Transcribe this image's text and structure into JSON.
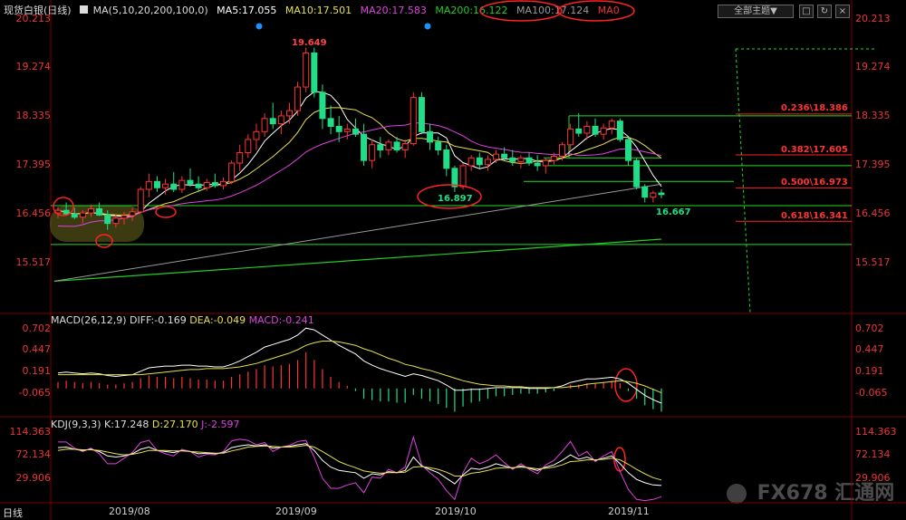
{
  "header": {
    "title": "现货白银(日线)",
    "ma_params": "MA(5,10,20,200,100,0)",
    "ma5": "MA5:17.055",
    "ma10": "MA10:17.501",
    "ma20": "MA20:17.583",
    "ma200": "MA200:16.122",
    "ma100": "MA100:17.124",
    "ma0": "MA0",
    "theme_button": "全部主题▼"
  },
  "colors": {
    "bg": "#000000",
    "up": "#ff3333",
    "down": "#22dd88",
    "axis": "#ff3333",
    "ma5": "#ffffff",
    "ma10": "#e8e04a",
    "ma20": "#e040e0",
    "ma100": "#999999",
    "ma200": "#22cc22"
  },
  "price_axis": [
    "20.213",
    "19.274",
    "18.335",
    "17.395",
    "16.456",
    "15.517"
  ],
  "annotations": {
    "high": "19.649",
    "low": "16.897",
    "last": "16.667"
  },
  "fib_levels": [
    "0.236\\18.386",
    "0.382\\17.605",
    "0.500\\16.973",
    "0.618\\16.341"
  ],
  "macd": {
    "label": "MACD(26,12,9)",
    "diff": "DIFF:-0.169",
    "dea": "DEA:-0.049",
    "macd": "MACD:-0.241",
    "axis": [
      "0.702",
      "0.447",
      "0.191",
      "-0.065"
    ]
  },
  "kdj": {
    "label": "KDJ(9,3,3)",
    "k": "K:17.248",
    "d": "D:27.170",
    "j": "J:-2.597",
    "axis": [
      "114.363",
      "72.134",
      "29.906"
    ]
  },
  "x_axis": [
    "2019/08",
    "2019/09",
    "2019/10",
    "2019/11"
  ],
  "footer": {
    "period": "日线",
    "watermark_brand": "FX678",
    "watermark_cn": "汇通网"
  },
  "chart_data": {
    "type": "candlestick",
    "title": "现货白银(日线)",
    "ylim": [
      15.3,
      20.4
    ],
    "ohlc": [
      [
        16.5,
        16.62,
        16.4,
        16.55
      ],
      [
        16.55,
        16.7,
        16.45,
        16.48
      ],
      [
        16.48,
        16.6,
        16.38,
        16.42
      ],
      [
        16.42,
        16.55,
        16.3,
        16.5
      ],
      [
        16.5,
        16.66,
        16.42,
        16.58
      ],
      [
        16.58,
        16.7,
        16.44,
        16.46
      ],
      [
        16.46,
        16.55,
        16.18,
        16.3
      ],
      [
        16.3,
        16.48,
        16.22,
        16.4
      ],
      [
        16.4,
        16.52,
        16.28,
        16.45
      ],
      [
        16.45,
        16.6,
        16.35,
        16.52
      ],
      [
        16.52,
        17.0,
        16.5,
        16.95
      ],
      [
        16.95,
        17.25,
        16.8,
        17.1
      ],
      [
        17.1,
        17.2,
        16.9,
        16.98
      ],
      [
        16.98,
        17.15,
        16.85,
        17.05
      ],
      [
        17.05,
        17.28,
        16.9,
        16.95
      ],
      [
        16.95,
        17.2,
        16.88,
        17.12
      ],
      [
        17.12,
        17.35,
        17.0,
        17.05
      ],
      [
        17.05,
        17.2,
        16.9,
        16.98
      ],
      [
        16.98,
        17.15,
        16.92,
        17.08
      ],
      [
        17.08,
        17.25,
        16.98,
        17.02
      ],
      [
        17.02,
        17.18,
        16.95,
        17.1
      ],
      [
        17.1,
        17.5,
        17.05,
        17.45
      ],
      [
        17.45,
        17.8,
        17.3,
        17.65
      ],
      [
        17.65,
        18.0,
        17.55,
        17.9
      ],
      [
        17.9,
        18.2,
        17.7,
        18.05
      ],
      [
        18.05,
        18.4,
        17.95,
        18.3
      ],
      [
        18.3,
        18.6,
        18.1,
        18.2
      ],
      [
        18.2,
        18.45,
        18.0,
        18.35
      ],
      [
        18.35,
        18.6,
        18.2,
        18.45
      ],
      [
        18.45,
        19.0,
        18.35,
        18.9
      ],
      [
        18.9,
        19.65,
        18.8,
        19.55
      ],
      [
        19.55,
        19.65,
        18.7,
        18.8
      ],
      [
        18.8,
        18.95,
        18.1,
        18.3
      ],
      [
        18.3,
        18.55,
        18.0,
        18.15
      ],
      [
        18.15,
        18.35,
        17.85,
        18.05
      ],
      [
        18.05,
        18.2,
        17.9,
        18.1
      ],
      [
        18.1,
        18.3,
        17.95,
        18.0
      ],
      [
        18.0,
        18.2,
        17.4,
        17.5
      ],
      [
        17.5,
        17.9,
        17.35,
        17.8
      ],
      [
        17.8,
        17.95,
        17.55,
        17.7
      ],
      [
        17.7,
        17.9,
        17.6,
        17.85
      ],
      [
        17.85,
        17.95,
        17.65,
        17.7
      ],
      [
        17.7,
        17.9,
        17.55,
        17.82
      ],
      [
        17.82,
        18.8,
        17.78,
        18.7
      ],
      [
        18.7,
        18.8,
        18.0,
        18.05
      ],
      [
        18.05,
        18.2,
        17.7,
        17.85
      ],
      [
        17.85,
        17.95,
        17.6,
        17.7
      ],
      [
        17.7,
        17.8,
        17.2,
        17.35
      ],
      [
        17.35,
        17.4,
        16.9,
        17.0
      ],
      [
        17.0,
        17.45,
        16.95,
        17.4
      ],
      [
        17.4,
        17.6,
        17.3,
        17.55
      ],
      [
        17.55,
        17.65,
        17.35,
        17.42
      ],
      [
        17.42,
        17.6,
        17.3,
        17.52
      ],
      [
        17.52,
        17.7,
        17.45,
        17.62
      ],
      [
        17.62,
        17.75,
        17.5,
        17.55
      ],
      [
        17.55,
        17.7,
        17.4,
        17.48
      ],
      [
        17.48,
        17.6,
        17.35,
        17.55
      ],
      [
        17.55,
        17.65,
        17.4,
        17.45
      ],
      [
        17.45,
        17.6,
        17.3,
        17.4
      ],
      [
        17.4,
        17.55,
        17.25,
        17.5
      ],
      [
        17.5,
        17.65,
        17.42,
        17.58
      ],
      [
        17.58,
        17.85,
        17.5,
        17.8
      ],
      [
        17.8,
        18.2,
        17.7,
        18.1
      ],
      [
        18.1,
        18.4,
        17.95,
        18.02
      ],
      [
        18.02,
        18.25,
        17.9,
        18.15
      ],
      [
        18.15,
        18.3,
        17.95,
        18.0
      ],
      [
        18.0,
        18.2,
        17.9,
        18.12
      ],
      [
        18.12,
        18.3,
        18.0,
        18.25
      ],
      [
        18.25,
        18.3,
        17.85,
        17.9
      ],
      [
        17.9,
        17.95,
        17.4,
        17.5
      ],
      [
        17.5,
        17.55,
        16.95,
        17.0
      ],
      [
        17.0,
        17.05,
        16.7,
        16.8
      ],
      [
        16.8,
        16.92,
        16.7,
        16.88
      ],
      [
        16.88,
        16.95,
        16.78,
        16.85
      ]
    ],
    "fib": [
      {
        "level": 0.236,
        "price": 18.386
      },
      {
        "level": 0.382,
        "price": 17.605
      },
      {
        "level": 0.5,
        "price": 16.973
      },
      {
        "level": 0.618,
        "price": 16.341
      }
    ],
    "macd_ylim": [
      -0.3,
      0.85
    ],
    "macd_hist": [
      0.05,
      0.06,
      0.05,
      0.04,
      0.05,
      0.04,
      0.03,
      0.03,
      0.04,
      0.05,
      0.08,
      0.1,
      0.09,
      0.09,
      0.08,
      0.09,
      0.08,
      0.07,
      0.07,
      0.06,
      0.06,
      0.09,
      0.11,
      0.13,
      0.15,
      0.18,
      0.17,
      0.18,
      0.19,
      0.22,
      0.28,
      0.22,
      0.15,
      0.09,
      0.05,
      0.02,
      -0.02,
      -0.08,
      -0.09,
      -0.1,
      -0.1,
      -0.11,
      -0.11,
      -0.05,
      -0.08,
      -0.1,
      -0.12,
      -0.15,
      -0.18,
      -0.14,
      -0.11,
      -0.1,
      -0.08,
      -0.06,
      -0.06,
      -0.05,
      -0.04,
      -0.04,
      -0.04,
      -0.03,
      -0.02,
      0.0,
      0.03,
      0.03,
      0.04,
      0.04,
      0.05,
      0.06,
      0.04,
      -0.02,
      -0.08,
      -0.13,
      -0.16,
      -0.18
    ],
    "macd_diff": [
      0.18,
      0.19,
      0.18,
      0.17,
      0.18,
      0.17,
      0.15,
      0.14,
      0.15,
      0.16,
      0.2,
      0.24,
      0.25,
      0.26,
      0.26,
      0.27,
      0.27,
      0.26,
      0.26,
      0.25,
      0.25,
      0.28,
      0.32,
      0.37,
      0.42,
      0.48,
      0.51,
      0.54,
      0.57,
      0.62,
      0.7,
      0.68,
      0.62,
      0.56,
      0.5,
      0.45,
      0.4,
      0.32,
      0.27,
      0.23,
      0.2,
      0.17,
      0.14,
      0.17,
      0.15,
      0.12,
      0.09,
      0.04,
      -0.02,
      -0.02,
      -0.01,
      -0.01,
      0.0,
      0.01,
      0.01,
      0.01,
      0.01,
      0.0,
      0.0,
      0.0,
      0.01,
      0.03,
      0.07,
      0.09,
      0.11,
      0.11,
      0.12,
      0.13,
      0.11,
      0.06,
      -0.01,
      -0.08,
      -0.13,
      -0.17
    ],
    "macd_dea": [
      0.16,
      0.16,
      0.16,
      0.16,
      0.16,
      0.16,
      0.16,
      0.16,
      0.16,
      0.16,
      0.16,
      0.17,
      0.18,
      0.19,
      0.2,
      0.21,
      0.22,
      0.22,
      0.23,
      0.23,
      0.23,
      0.24,
      0.25,
      0.27,
      0.29,
      0.32,
      0.35,
      0.38,
      0.41,
      0.45,
      0.5,
      0.53,
      0.55,
      0.55,
      0.54,
      0.52,
      0.5,
      0.46,
      0.43,
      0.39,
      0.35,
      0.32,
      0.28,
      0.26,
      0.23,
      0.21,
      0.18,
      0.15,
      0.12,
      0.09,
      0.07,
      0.05,
      0.04,
      0.03,
      0.03,
      0.02,
      0.02,
      0.01,
      0.01,
      0.01,
      0.01,
      0.01,
      0.02,
      0.03,
      0.05,
      0.06,
      0.07,
      0.08,
      0.09,
      0.08,
      0.06,
      0.03,
      -0.01,
      -0.05
    ],
    "kdj_ylim": [
      0,
      120
    ],
    "kdj_k": [
      85,
      86,
      82,
      80,
      82,
      78,
      70,
      68,
      70,
      74,
      82,
      86,
      80,
      78,
      76,
      80,
      78,
      74,
      75,
      74,
      76,
      85,
      88,
      90,
      88,
      90,
      84,
      86,
      87,
      90,
      92,
      80,
      62,
      50,
      44,
      42,
      40,
      30,
      38,
      36,
      42,
      40,
      44,
      68,
      52,
      46,
      40,
      30,
      20,
      36,
      48,
      46,
      50,
      56,
      52,
      48,
      52,
      48,
      44,
      50,
      54,
      62,
      72,
      64,
      68,
      62,
      66,
      70,
      56,
      40,
      28,
      22,
      18,
      17
    ],
    "kdj_d": [
      80,
      82,
      82,
      81,
      81,
      80,
      77,
      74,
      72,
      73,
      76,
      80,
      80,
      80,
      79,
      79,
      78,
      77,
      76,
      75,
      75,
      79,
      82,
      86,
      87,
      88,
      87,
      86,
      86,
      87,
      89,
      86,
      78,
      69,
      60,
      54,
      49,
      43,
      41,
      39,
      40,
      40,
      41,
      50,
      51,
      49,
      46,
      41,
      34,
      34,
      39,
      41,
      44,
      48,
      49,
      49,
      50,
      49,
      47,
      48,
      50,
      54,
      60,
      61,
      63,
      63,
      64,
      66,
      63,
      55,
      46,
      38,
      31,
      27
    ],
    "kdj_j": [
      95,
      95,
      84,
      78,
      84,
      74,
      56,
      56,
      66,
      76,
      94,
      98,
      80,
      74,
      70,
      82,
      78,
      68,
      73,
      72,
      78,
      97,
      100,
      98,
      90,
      94,
      78,
      86,
      89,
      96,
      98,
      68,
      30,
      12,
      12,
      18,
      22,
      4,
      32,
      30,
      46,
      40,
      50,
      104,
      54,
      40,
      28,
      8,
      -8,
      40,
      66,
      56,
      62,
      72,
      58,
      46,
      56,
      46,
      38,
      54,
      62,
      78,
      96,
      70,
      78,
      60,
      70,
      78,
      42,
      10,
      -8,
      -10,
      -8,
      -3
    ]
  }
}
